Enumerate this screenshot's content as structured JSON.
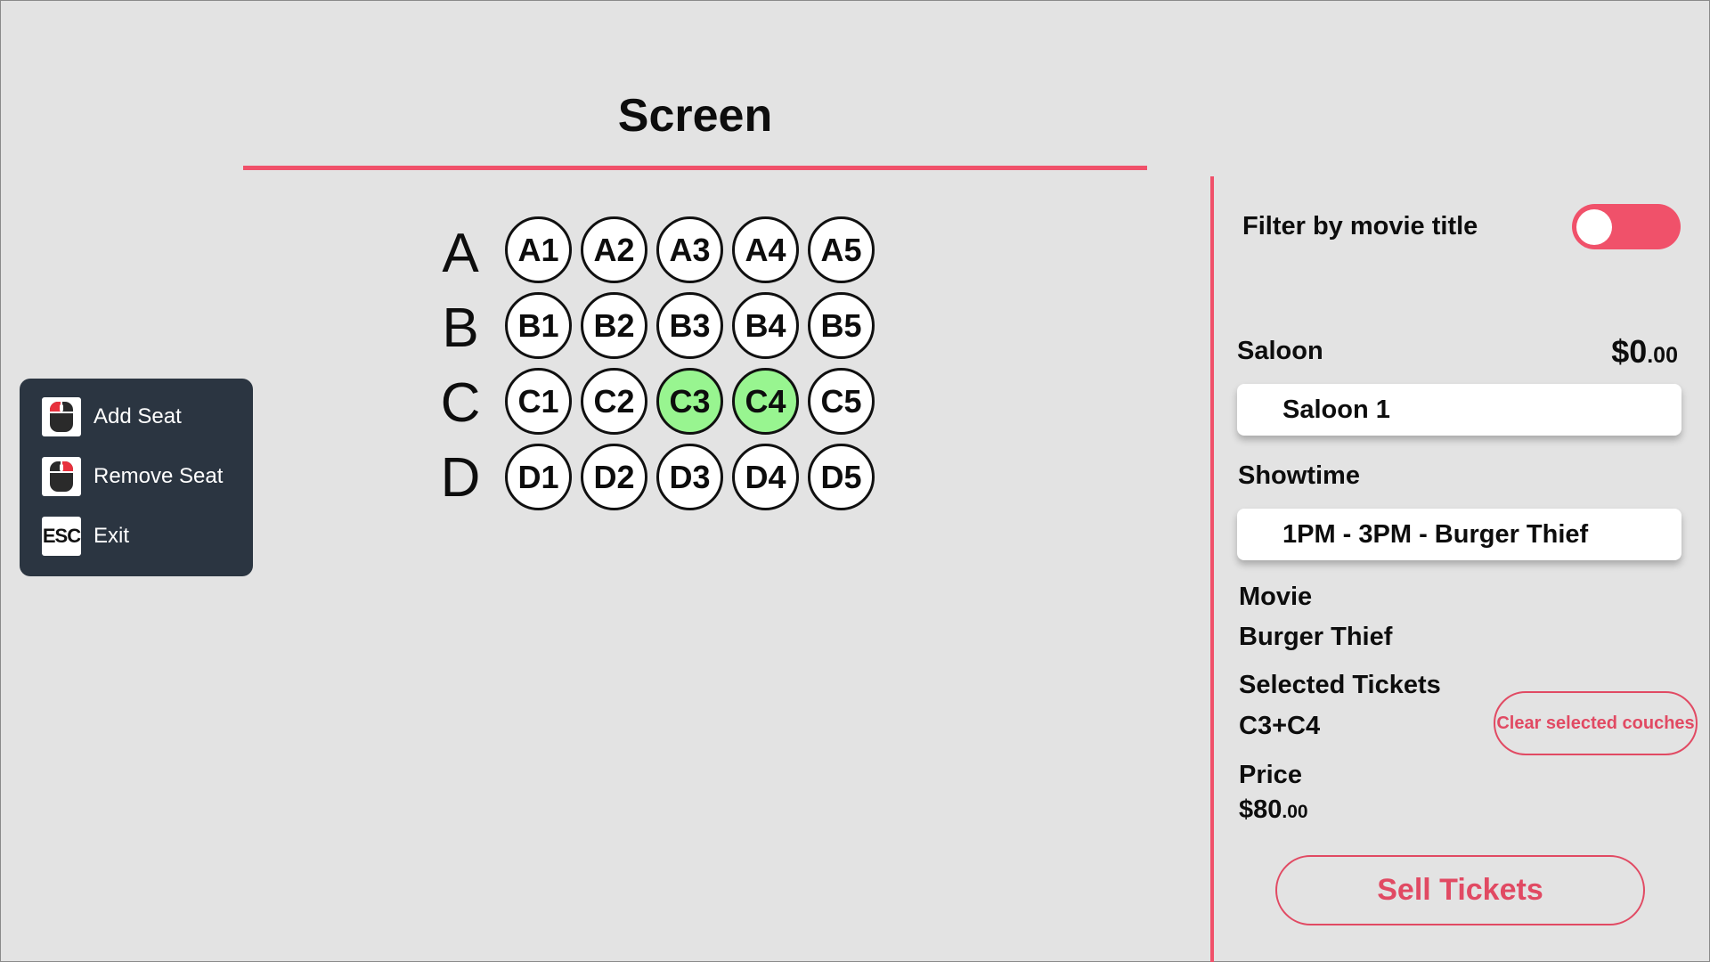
{
  "screen": {
    "title": "Screen"
  },
  "rows": [
    {
      "letter": "A",
      "seats": [
        {
          "id": "A1",
          "selected": false
        },
        {
          "id": "A2",
          "selected": false
        },
        {
          "id": "A3",
          "selected": false
        },
        {
          "id": "A4",
          "selected": false
        },
        {
          "id": "A5",
          "selected": false
        }
      ]
    },
    {
      "letter": "B",
      "seats": [
        {
          "id": "B1",
          "selected": false
        },
        {
          "id": "B2",
          "selected": false
        },
        {
          "id": "B3",
          "selected": false
        },
        {
          "id": "B4",
          "selected": false
        },
        {
          "id": "B5",
          "selected": false
        }
      ]
    },
    {
      "letter": "C",
      "seats": [
        {
          "id": "C1",
          "selected": false
        },
        {
          "id": "C2",
          "selected": false
        },
        {
          "id": "C3",
          "selected": true
        },
        {
          "id": "C4",
          "selected": true
        },
        {
          "id": "C5",
          "selected": false
        }
      ]
    },
    {
      "letter": "D",
      "seats": [
        {
          "id": "D1",
          "selected": false
        },
        {
          "id": "D2",
          "selected": false
        },
        {
          "id": "D3",
          "selected": false
        },
        {
          "id": "D4",
          "selected": false
        },
        {
          "id": "D5",
          "selected": false
        }
      ]
    }
  ],
  "shortcuts": [
    {
      "icon": "mouse-left-click-icon",
      "label": "Add Seat"
    },
    {
      "icon": "mouse-right-click-icon",
      "label": "Remove Seat"
    },
    {
      "icon": "esc-key-icon",
      "key": "ESC",
      "label": "Exit"
    }
  ],
  "panel": {
    "filter_label": "Filter by movie title",
    "filter_on": true,
    "saloon_label": "Saloon",
    "saloon_price": "$0",
    "saloon_price_cents": ".00",
    "saloon_value": "Saloon 1",
    "showtime_label": "Showtime",
    "showtime_value": "1PM - 3PM - Burger Thief",
    "movie_label": "Movie",
    "movie_value": "Burger Thief",
    "tickets_label": "Selected Tickets",
    "tickets_value": "C3+C4",
    "clear_button": "Clear selected couches",
    "price_label": "Price",
    "price_value": "$80",
    "price_cents": ".00",
    "sell_button": "Sell Tickets"
  },
  "colors": {
    "accent": "#f0516a",
    "selected_seat": "#98f590",
    "shortcut_panel": "#2b3541",
    "background": "#e3e3e3"
  }
}
